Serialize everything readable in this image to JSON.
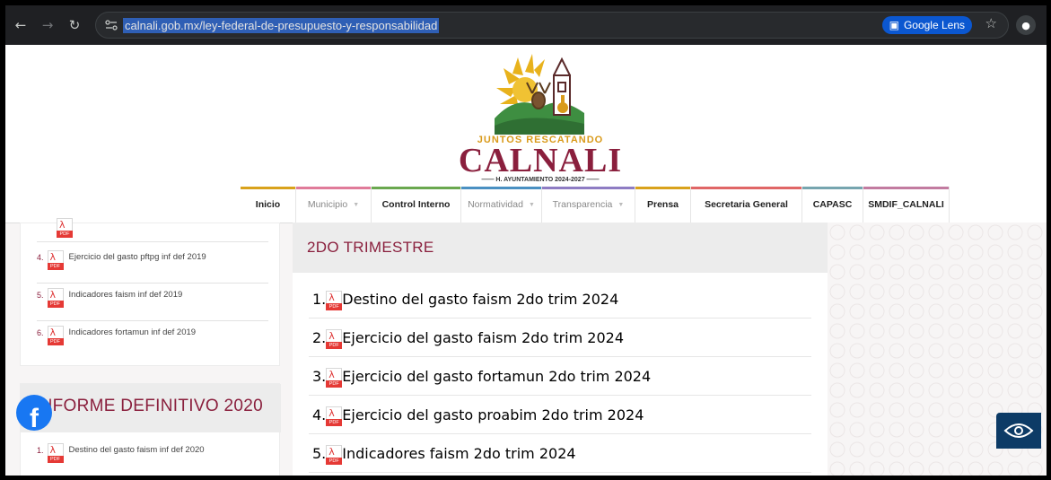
{
  "browser": {
    "url": "calnali.gob.mx/ley-federal-de-presupuesto-y-responsabilidad",
    "lens_label": "Google Lens",
    "icons": [
      "back-icon",
      "forward-icon",
      "reload-icon",
      "site-info-icon",
      "google-lens-icon",
      "star-icon",
      "profile-icon"
    ]
  },
  "logo": {
    "tagline": "JUNTOS RESCATANDO",
    "name": "CALNALI",
    "subtitle": "H. AYUNTAMIENTO 2024-2027",
    "colors": {
      "sun": "#e8b21c",
      "hills": "#3e8e41",
      "maroon": "#8a1f3d"
    }
  },
  "nav": {
    "items": [
      {
        "label": "Inicio",
        "bold": true,
        "dropdown": false,
        "accent": "#d9a21b"
      },
      {
        "label": "Municipio",
        "bold": false,
        "dropdown": true,
        "accent": "#e07b9a"
      },
      {
        "label": "Control Interno",
        "bold": true,
        "dropdown": false,
        "accent": "#6aa84f"
      },
      {
        "label": "Normatividad",
        "bold": false,
        "dropdown": true,
        "accent": "#4a90c2"
      },
      {
        "label": "Transparencia",
        "bold": false,
        "dropdown": true,
        "accent": "#8e7cc3"
      },
      {
        "label": "Prensa",
        "bold": true,
        "dropdown": false,
        "accent": "#d9a21b"
      },
      {
        "label": "Secretaria General",
        "bold": true,
        "dropdown": false,
        "accent": "#e06666"
      },
      {
        "label": "CAPASC",
        "bold": true,
        "dropdown": false,
        "accent": "#76a5af"
      },
      {
        "label": "SMDIF_CALNALI",
        "bold": true,
        "dropdown": false,
        "accent": "#c27ba0"
      }
    ]
  },
  "left": {
    "items": [
      {
        "num": "4.",
        "text": "Ejercicio del gasto pftpg inf def 2019"
      },
      {
        "num": "5.",
        "text": "Indicadores faism inf def 2019"
      },
      {
        "num": "6.",
        "text": "Indicadores fortamun inf def 2019"
      }
    ],
    "informe_title": "INFORME DEFINITIVO 2020",
    "informe_items": [
      {
        "num": "1.",
        "text": "Destino del gasto faism inf def 2020"
      }
    ]
  },
  "main": {
    "title": "2DO TRIMESTRE",
    "items": [
      {
        "num": "1.",
        "text": "Destino del gasto faism 2do trim 2024"
      },
      {
        "num": "2.",
        "text": "Ejercicio del gasto faism 2do trim 2024"
      },
      {
        "num": "3.",
        "text": "Ejercicio del gasto fortamun 2do trim 2024"
      },
      {
        "num": "4.",
        "text": "Ejercicio del gasto proabim 2do trim 2024"
      },
      {
        "num": "5.",
        "text": "Indicadores faism 2do trim 2024"
      }
    ]
  },
  "pdf_badge": "PDF",
  "facebook_glyph": "f",
  "accessibility": {
    "icon": "eye-icon"
  }
}
